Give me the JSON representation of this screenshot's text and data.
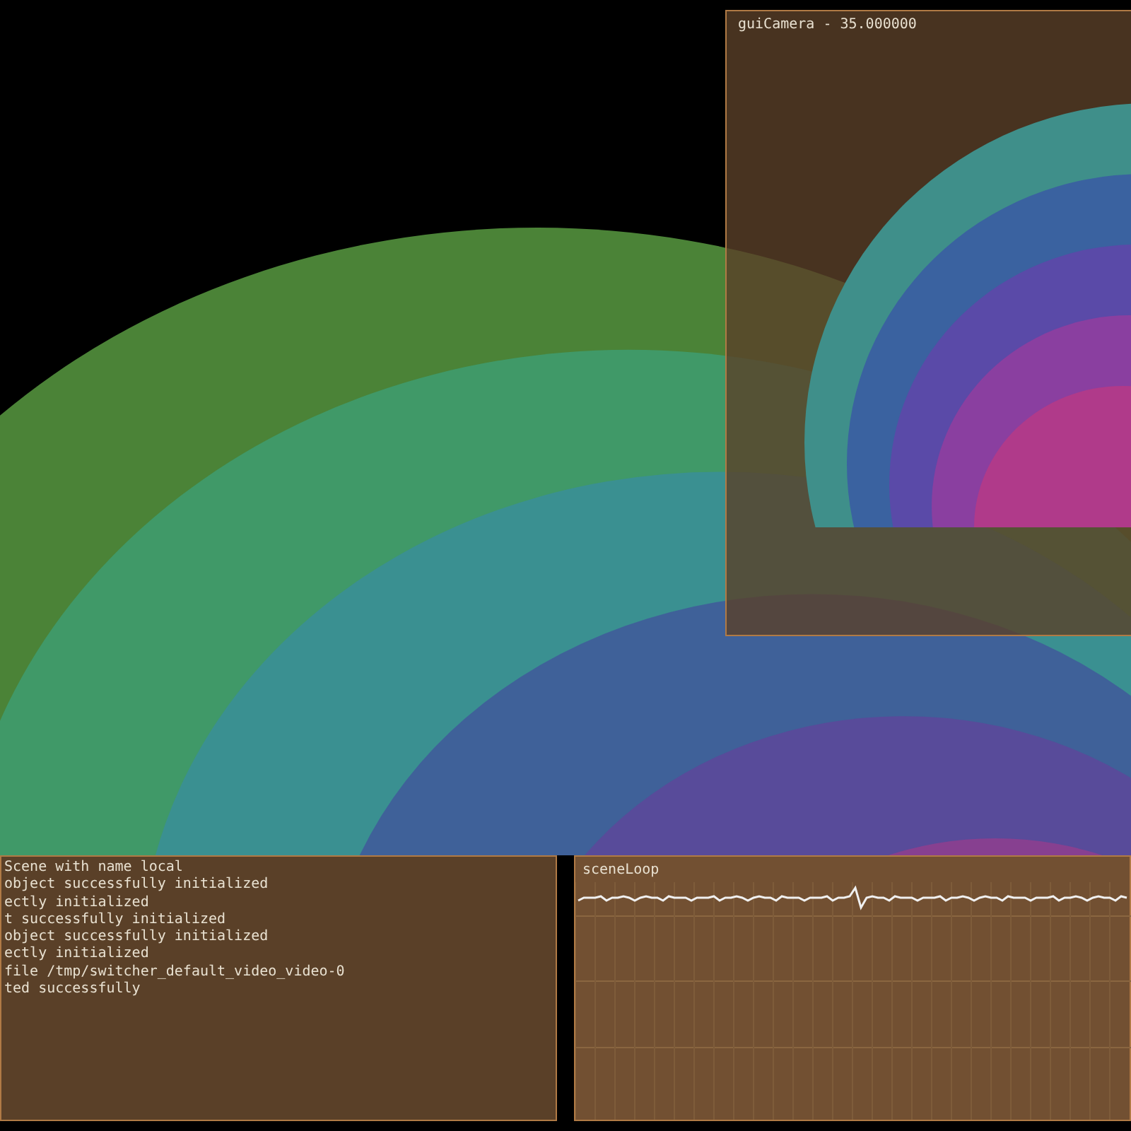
{
  "camera_view": {
    "title": "guiCamera - 35.000000"
  },
  "console": {
    "lines": [
      "Scene with name local",
      "object successfully initialized",
      "ectly initialized",
      "t successfully initialized",
      "object successfully initialized",
      "ectly initialized",
      "file /tmp/switcher_default_video_video-0",
      "ted successfully"
    ]
  },
  "graph": {
    "title": "sceneLoop"
  }
}
